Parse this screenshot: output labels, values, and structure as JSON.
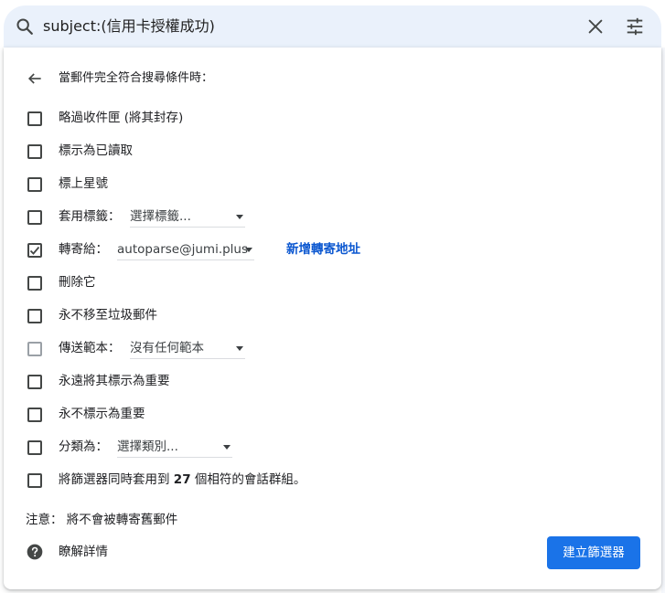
{
  "search": {
    "query": "subject:(信用卡授權成功)"
  },
  "panel": {
    "header": "當郵件完全符合搜尋條件時：",
    "options": [
      {
        "label": "略過收件匣 (將其封存)",
        "checked": false
      },
      {
        "label": "標示為已讀取",
        "checked": false
      },
      {
        "label": "標上星號",
        "checked": false
      },
      {
        "label": "套用標籤：",
        "checked": false,
        "select": "選擇標籤..."
      },
      {
        "label": "轉寄給：",
        "checked": true,
        "select": "autoparse@jumi.plus",
        "link": "新增轉寄地址"
      },
      {
        "label": "刪除它",
        "checked": false
      },
      {
        "label": "永不移至垃圾郵件",
        "checked": false
      },
      {
        "label": "傳送範本：",
        "checked": false,
        "disabled": true,
        "select": "沒有任何範本"
      },
      {
        "label": "永遠將其標示為重要",
        "checked": false
      },
      {
        "label": "永不標示為重要",
        "checked": false
      },
      {
        "label": "分類為：",
        "checked": false,
        "select": "選擇類別..."
      },
      {
        "label_prefix": "將篩選器同時套用到",
        "label_count": "27",
        "label_suffix": "個相符的會話群組。",
        "checked": false
      }
    ],
    "note": "注意： 將不會被轉寄舊郵件",
    "help": "瞭解詳情",
    "create_button": "建立篩選器"
  },
  "colors": {
    "search_bg": "#eaf1fb",
    "primary": "#1a73e8",
    "link": "#0b57d0"
  }
}
